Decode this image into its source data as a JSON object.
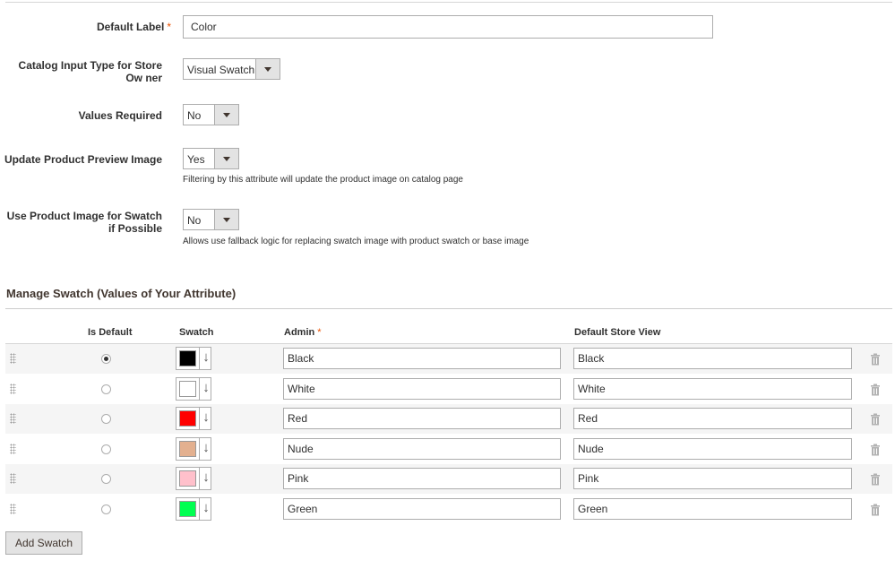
{
  "properties": {
    "default_label": {
      "label": "Default Label",
      "required_mark": "*",
      "value": "Color"
    },
    "catalog_input_type": {
      "label": "Catalog Input Type for Store Ow ner",
      "value": "Visual Swatch"
    },
    "values_required": {
      "label": "Values Required",
      "value": "No"
    },
    "update_preview": {
      "label": "Update Product Preview Image",
      "value": "Yes",
      "note": "Filtering by this attribute will update the product image on catalog page"
    },
    "use_product_image": {
      "label": "Use Product Image for Swatch if Possible",
      "value": "No",
      "note": "Allows use fallback logic for replacing swatch image with product swatch or base image"
    }
  },
  "swatches": {
    "title": "Manage Swatch (Values of Your Attribute)",
    "columns": {
      "is_default": "Is Default",
      "swatch": "Swatch",
      "admin": "Admin",
      "admin_required": "*",
      "store_view": "Default Store View"
    },
    "rows": [
      {
        "admin": "Black",
        "store_view": "Black",
        "color": "#000000",
        "is_default": true
      },
      {
        "admin": "White",
        "store_view": "White",
        "color": "#ffffff",
        "is_default": false
      },
      {
        "admin": "Red",
        "store_view": "Red",
        "color": "#ff0000",
        "is_default": false
      },
      {
        "admin": "Nude",
        "store_view": "Nude",
        "color": "#e3b08f",
        "is_default": false
      },
      {
        "admin": "Pink",
        "store_view": "Pink",
        "color": "#ffc0cb",
        "is_default": false
      },
      {
        "admin": "Green",
        "store_view": "Green",
        "color": "#00ff51",
        "is_default": false
      }
    ],
    "add_label": "Add Swatch"
  },
  "icons": {
    "drag": "drag-handle-icon",
    "delete": "trash-icon",
    "swatch_menu": "arrow-down-icon"
  },
  "colors": {
    "required": "#eb5202",
    "alt_row": "#f5f5f5"
  }
}
